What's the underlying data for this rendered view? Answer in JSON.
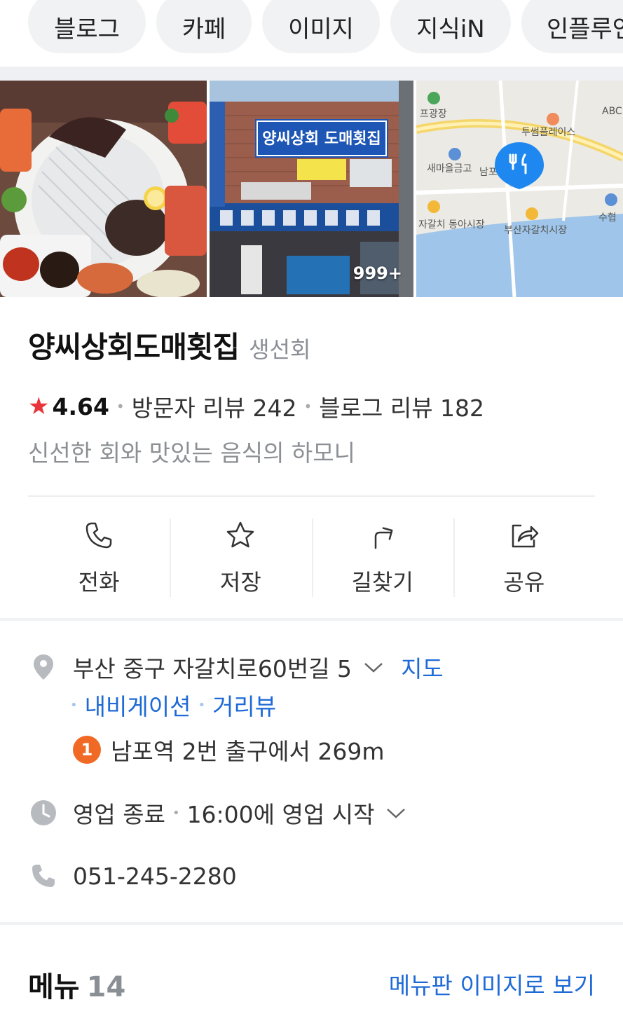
{
  "chips": [
    "블로그",
    "카페",
    "이미지",
    "지식iN",
    "인플루언"
  ],
  "photos": {
    "count_label": "999+",
    "sign_text": "양씨상회 도매횟집",
    "map_labels": [
      "프광장",
      "투썸플레이스",
      "새마을금고",
      "남포동",
      "자갈치 동아시장",
      "부산자갈치시장",
      "수협",
      "ABC"
    ]
  },
  "place": {
    "name": "양씨상회도매횟집",
    "category": "생선회",
    "rating": "4.64",
    "visitor_reviews": "방문자 리뷰 242",
    "blog_reviews": "블로그 리뷰 182",
    "description": "신선한 회와 맛있는 음식의 하모니"
  },
  "actions": [
    {
      "label": "전화",
      "icon": "phone-icon"
    },
    {
      "label": "저장",
      "icon": "star-icon"
    },
    {
      "label": "길찾기",
      "icon": "directions-icon"
    },
    {
      "label": "공유",
      "icon": "share-icon"
    }
  ],
  "info": {
    "address": "부산 중구 자갈치로60번길 5",
    "map_link": "지도",
    "navigation_link": "내비게이션",
    "streetview_link": "거리뷰",
    "subway_line": "1",
    "subway_text": "남포역 2번 출구에서 269m",
    "hours_status": "영업 종료",
    "hours_next": "16:00에 영업 시작",
    "phone": "051-245-2280"
  },
  "menu": {
    "title": "메뉴",
    "count": "14",
    "board_link": "메뉴판 이미지로 보기"
  },
  "colors": {
    "link": "#1e6ad6",
    "star": "#e8343a",
    "subway_line1": "#f06a25",
    "chip_bg": "#f1f2f4"
  }
}
